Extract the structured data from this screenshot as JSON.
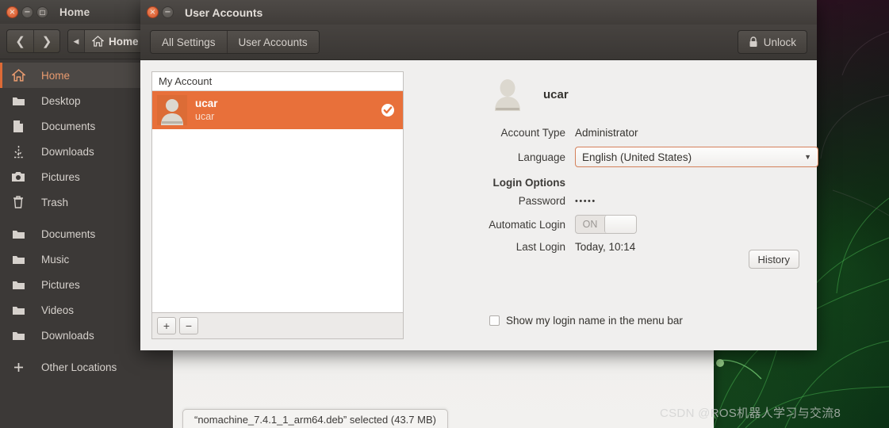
{
  "desktop": {
    "watermark": "CSDN @ROS机器人学习与交流8"
  },
  "file_manager": {
    "title": "Home",
    "window_buttons": {
      "close": "close-icon",
      "minimize": "minimize-icon",
      "maximize": "maximize-icon"
    },
    "nav": {
      "back": "back-arrow-icon",
      "forward": "forward-arrow-icon",
      "path_prev": "path-prev-icon"
    },
    "breadcrumb": "Home",
    "sidebar": [
      {
        "label": "Home",
        "icon": "home-icon",
        "selected": true
      },
      {
        "label": "Desktop",
        "icon": "folder-icon",
        "selected": false
      },
      {
        "label": "Documents",
        "icon": "document-icon",
        "selected": false
      },
      {
        "label": "Downloads",
        "icon": "download-icon",
        "selected": false
      },
      {
        "label": "Pictures",
        "icon": "camera-icon",
        "selected": false
      },
      {
        "label": "Trash",
        "icon": "trash-icon",
        "selected": false
      },
      {
        "label": "Documents",
        "icon": "folder-icon",
        "selected": false
      },
      {
        "label": "Music",
        "icon": "folder-icon",
        "selected": false
      },
      {
        "label": "Pictures",
        "icon": "folder-icon",
        "selected": false
      },
      {
        "label": "Videos",
        "icon": "folder-icon",
        "selected": false
      },
      {
        "label": "Downloads",
        "icon": "folder-icon",
        "selected": false
      },
      {
        "label": "Other Locations",
        "icon": "plus-icon",
        "selected": false
      }
    ],
    "status": "“nomachine_7.4.1_1_arm64.deb” selected (43.7 MB)"
  },
  "dialog": {
    "title": "User Accounts",
    "tabs": [
      {
        "label": "All Settings"
      },
      {
        "label": "User Accounts"
      }
    ],
    "unlock": {
      "label": "Unlock",
      "icon": "lock-icon"
    },
    "account_list": {
      "header": "My Account",
      "rows": [
        {
          "name": "ucar",
          "sub": "ucar",
          "selected": true,
          "check_icon": "check-circle-icon"
        }
      ],
      "add_label": "+",
      "remove_label": "−"
    },
    "detail": {
      "avatar": "user-avatar-icon",
      "username": "ucar",
      "account_type_label": "Account Type",
      "account_type_value": "Administrator",
      "language_label": "Language",
      "language_value": "English (United States)",
      "login_options_label": "Login Options",
      "password_label": "Password",
      "password_value": "•••••",
      "automatic_login_label": "Automatic Login",
      "automatic_login_state": "ON",
      "last_login_label": "Last Login",
      "last_login_value": "Today, 10:14",
      "history_label": "History",
      "show_login_name_label": "Show my login name in the menu bar",
      "show_login_name_checked": false
    }
  },
  "colors": {
    "accent_orange": "#e8703a",
    "titlebar_dark": "#403c39",
    "sidebar_dark": "#3c3937",
    "dialog_bg": "#f0efee",
    "focus_border": "#d4805a"
  }
}
